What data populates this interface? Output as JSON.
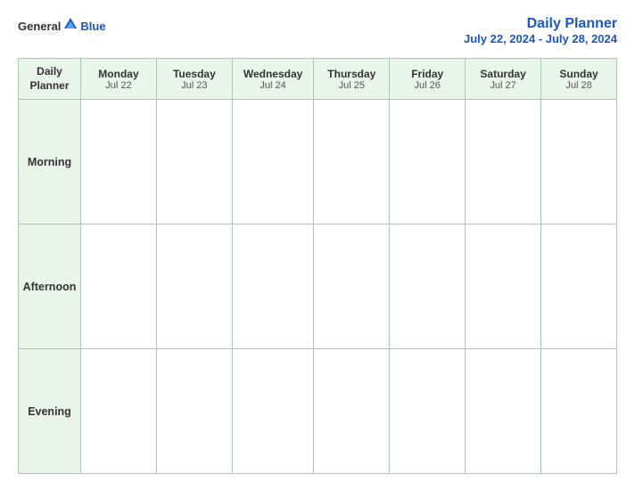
{
  "header": {
    "logo_general": "General",
    "logo_blue": "Blue",
    "title": "Daily Planner",
    "date_range": "July 22, 2024 - July 28, 2024"
  },
  "table": {
    "label_header_line1": "Daily",
    "label_header_line2": "Planner",
    "days": [
      {
        "name": "Monday",
        "date": "Jul 22"
      },
      {
        "name": "Tuesday",
        "date": "Jul 23"
      },
      {
        "name": "Wednesday",
        "date": "Jul 24"
      },
      {
        "name": "Thursday",
        "date": "Jul 25"
      },
      {
        "name": "Friday",
        "date": "Jul 26"
      },
      {
        "name": "Saturday",
        "date": "Jul 27"
      },
      {
        "name": "Sunday",
        "date": "Jul 28"
      }
    ],
    "rows": [
      {
        "label": "Morning"
      },
      {
        "label": "Afternoon"
      },
      {
        "label": "Evening"
      }
    ]
  }
}
